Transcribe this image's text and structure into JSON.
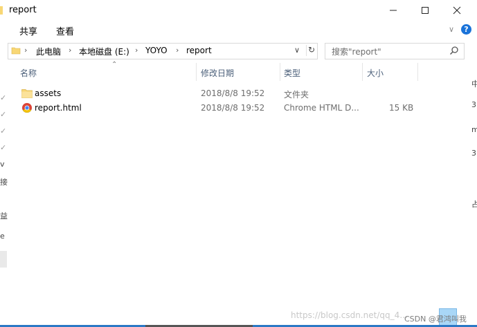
{
  "window": {
    "title": "report",
    "controls": {
      "minimize": "—",
      "maximize": "☐",
      "close": "✕"
    }
  },
  "ribbon": {
    "tabs": [
      "共享",
      "查看"
    ],
    "expand_glyph": "∨",
    "help_glyph": "?"
  },
  "address": {
    "segments": [
      "此电脑",
      "本地磁盘 (E:)",
      "YOYO",
      "report"
    ],
    "dropdown_glyph": "∨",
    "refresh_glyph": "↻"
  },
  "search": {
    "placeholder": "搜索\"report\""
  },
  "columns": {
    "name": "名称",
    "date": "修改日期",
    "type": "类型",
    "size": "大小"
  },
  "files": [
    {
      "name": "assets",
      "date": "2018/8/8 19:52",
      "type": "文件夹",
      "size": "",
      "icon": "folder-icon"
    },
    {
      "name": "report.html",
      "date": "2018/8/8 19:52",
      "type": "Chrome HTML D...",
      "size": "15 KB",
      "icon": "chrome-icon"
    }
  ],
  "left_fragments": [
    "✓",
    "✓",
    "✓",
    "✓",
    "v",
    "接",
    "益",
    "e"
  ],
  "right_fragments": [
    "中",
    "3",
    "m",
    "3",
    "占"
  ],
  "watermark": "https://blog.csdn.net/qq_4…",
  "csdn_badge": "CSDN @君鸿叫我",
  "colors": {
    "folder": "#f8d775",
    "help": "#1a73d9",
    "header_text": "#4c607a"
  }
}
